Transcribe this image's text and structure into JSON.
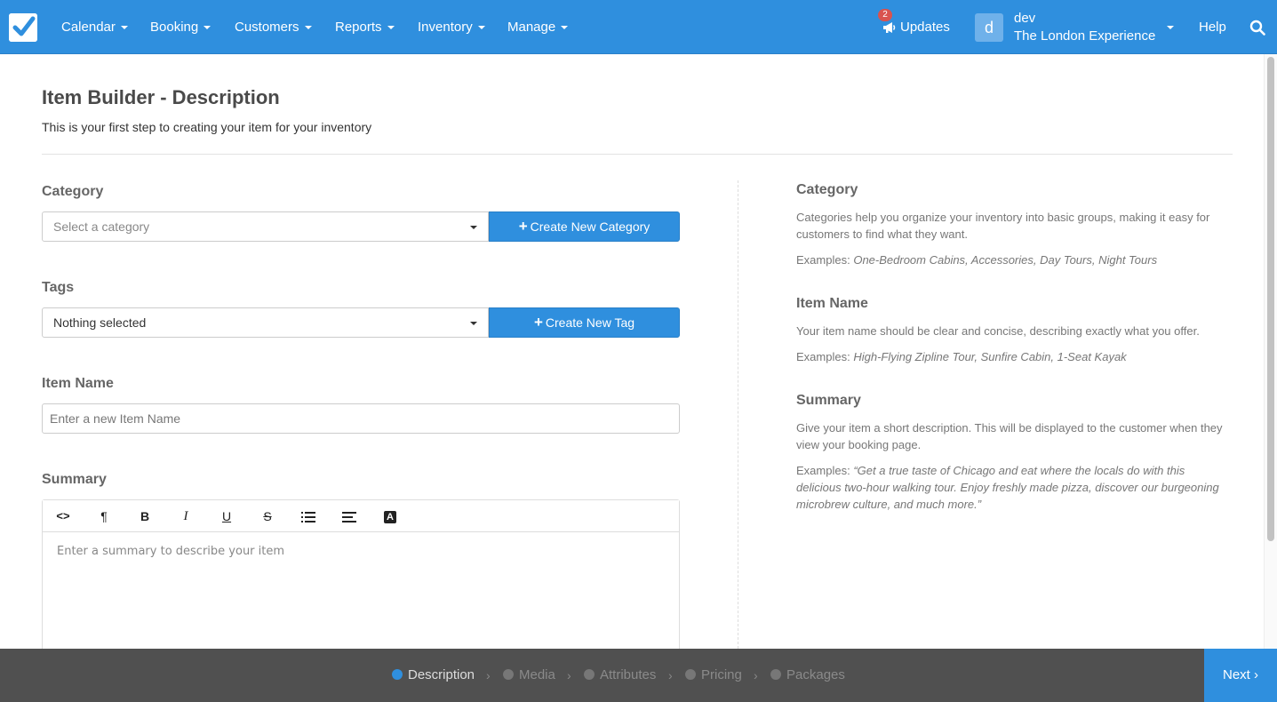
{
  "nav": {
    "items": [
      {
        "label": "Calendar"
      },
      {
        "label": "Booking"
      },
      {
        "label": "Customers"
      },
      {
        "label": "Reports"
      },
      {
        "label": "Inventory"
      },
      {
        "label": "Manage"
      }
    ],
    "updates_label": "Updates",
    "updates_count": "2",
    "user_initial": "d",
    "user_name": "dev",
    "user_company": "The London Experience",
    "help_label": "Help"
  },
  "page": {
    "title": "Item Builder - Description",
    "subtitle": "This is your first step to creating your item for your inventory"
  },
  "form": {
    "category_label": "Category",
    "category_placeholder": "Select a category",
    "create_category_label": "Create New Category",
    "tags_label": "Tags",
    "tags_value": "Nothing selected",
    "create_tag_label": "Create New Tag",
    "item_name_label": "Item Name",
    "item_name_placeholder": "Enter a new Item Name",
    "summary_label": "Summary",
    "summary_placeholder": "Enter a summary to describe your item",
    "toolbar_icons": [
      "code-view-icon",
      "paragraph-icon",
      "bold-icon",
      "italic-icon",
      "underline-icon",
      "strikethrough-icon",
      "list-icon",
      "align-icon",
      "font-color-icon"
    ],
    "toolbar_glyphs": [
      "<>",
      "¶",
      "B",
      "I",
      "U",
      "S",
      "",
      "",
      "A"
    ]
  },
  "help": {
    "category_title": "Category",
    "category_text": "Categories help you organize your inventory into basic groups, making it easy for customers to find what they want.",
    "category_examples_prefix": "Examples:",
    "category_examples": "One-Bedroom Cabins, Accessories, Day Tours, Night Tours",
    "item_name_title": "Item Name",
    "item_name_text": "Your item name should be clear and concise, describing exactly what you offer.",
    "item_name_examples_prefix": "Examples:",
    "item_name_examples": "High-Flying Zipline Tour, Sunfire Cabin, 1-Seat Kayak",
    "summary_title": "Summary",
    "summary_text": "Give your item a short description. This will be displayed to the customer when they view your booking page.",
    "summary_examples_prefix": "Examples:",
    "summary_examples": "“Get a true taste of Chicago and eat where the locals do with this delicious two-hour walking tour. Enjoy freshly made pizza, discover our burgeoning microbrew culture, and much more.”"
  },
  "steps": [
    {
      "label": "Description",
      "active": true
    },
    {
      "label": "Media",
      "active": false
    },
    {
      "label": "Attributes",
      "active": false
    },
    {
      "label": "Pricing",
      "active": false
    },
    {
      "label": "Packages",
      "active": false
    }
  ],
  "next_label": "Next",
  "colors": {
    "primary": "#2f8fde",
    "bottom_bar": "#505050",
    "badge": "#d9534f"
  }
}
